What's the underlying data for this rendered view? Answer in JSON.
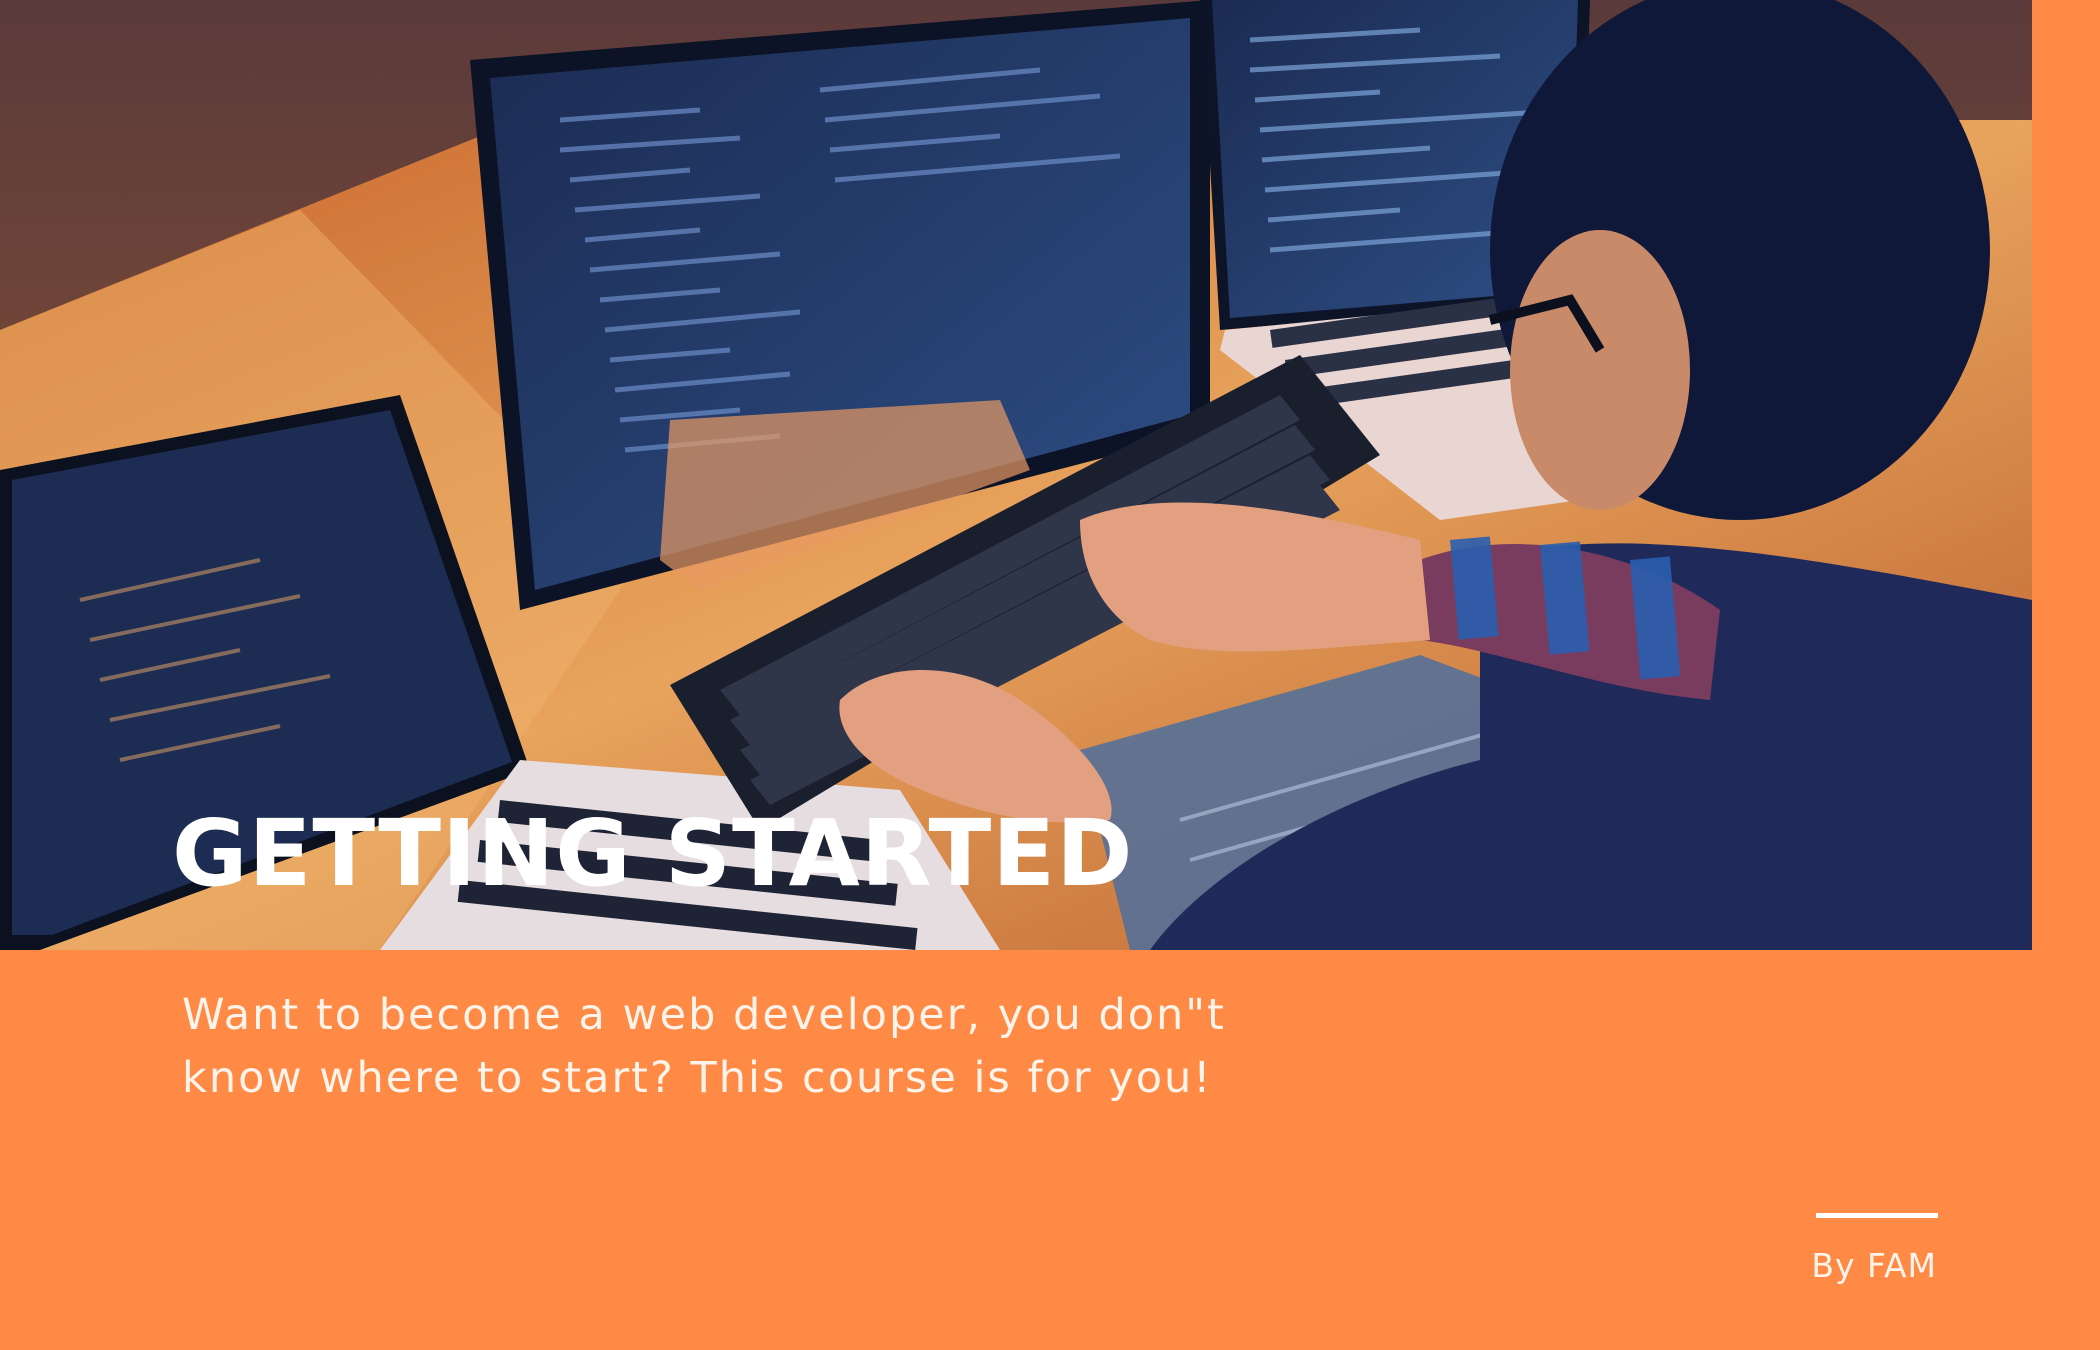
{
  "hero": {
    "title": "GETTING STARTED"
  },
  "tagline": {
    "line1": "Want to become a web developer, you don\"t",
    "line2": "know where to start? This course is for you!"
  },
  "author": {
    "label": "By FAM"
  },
  "colors": {
    "background": "#FF8A45",
    "text": "#FFFFFF"
  }
}
